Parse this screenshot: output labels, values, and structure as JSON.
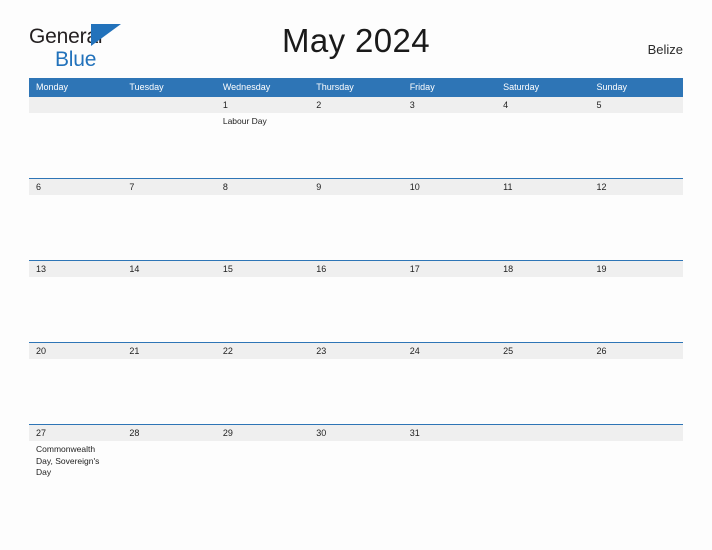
{
  "brand": {
    "name_part1": "General",
    "name_part2": "Blue",
    "flag_icon": "blue-flag-icon",
    "accent_color": "#2272bb"
  },
  "header": {
    "title": "May 2024",
    "region": "Belize"
  },
  "theme": {
    "header_blue": "#2e75b6",
    "band_gray": "#efefef",
    "page_background": "#fdfdfd"
  },
  "calendar": {
    "month": "May",
    "year": "2024",
    "weekday_headers": [
      "Monday",
      "Tuesday",
      "Wednesday",
      "Thursday",
      "Friday",
      "Saturday",
      "Sunday"
    ],
    "weeks": [
      {
        "days": [
          {
            "date": "",
            "events": ""
          },
          {
            "date": "",
            "events": ""
          },
          {
            "date": "1",
            "events": "Labour Day"
          },
          {
            "date": "2",
            "events": ""
          },
          {
            "date": "3",
            "events": ""
          },
          {
            "date": "4",
            "events": ""
          },
          {
            "date": "5",
            "events": ""
          }
        ]
      },
      {
        "days": [
          {
            "date": "6",
            "events": ""
          },
          {
            "date": "7",
            "events": ""
          },
          {
            "date": "8",
            "events": ""
          },
          {
            "date": "9",
            "events": ""
          },
          {
            "date": "10",
            "events": ""
          },
          {
            "date": "11",
            "events": ""
          },
          {
            "date": "12",
            "events": ""
          }
        ]
      },
      {
        "days": [
          {
            "date": "13",
            "events": ""
          },
          {
            "date": "14",
            "events": ""
          },
          {
            "date": "15",
            "events": ""
          },
          {
            "date": "16",
            "events": ""
          },
          {
            "date": "17",
            "events": ""
          },
          {
            "date": "18",
            "events": ""
          },
          {
            "date": "19",
            "events": ""
          }
        ]
      },
      {
        "days": [
          {
            "date": "20",
            "events": ""
          },
          {
            "date": "21",
            "events": ""
          },
          {
            "date": "22",
            "events": ""
          },
          {
            "date": "23",
            "events": ""
          },
          {
            "date": "24",
            "events": ""
          },
          {
            "date": "25",
            "events": ""
          },
          {
            "date": "26",
            "events": ""
          }
        ]
      },
      {
        "days": [
          {
            "date": "27",
            "events": "Commonwealth Day, Sovereign's Day"
          },
          {
            "date": "28",
            "events": ""
          },
          {
            "date": "29",
            "events": ""
          },
          {
            "date": "30",
            "events": ""
          },
          {
            "date": "31",
            "events": ""
          },
          {
            "date": "",
            "events": ""
          },
          {
            "date": "",
            "events": ""
          }
        ]
      }
    ]
  }
}
